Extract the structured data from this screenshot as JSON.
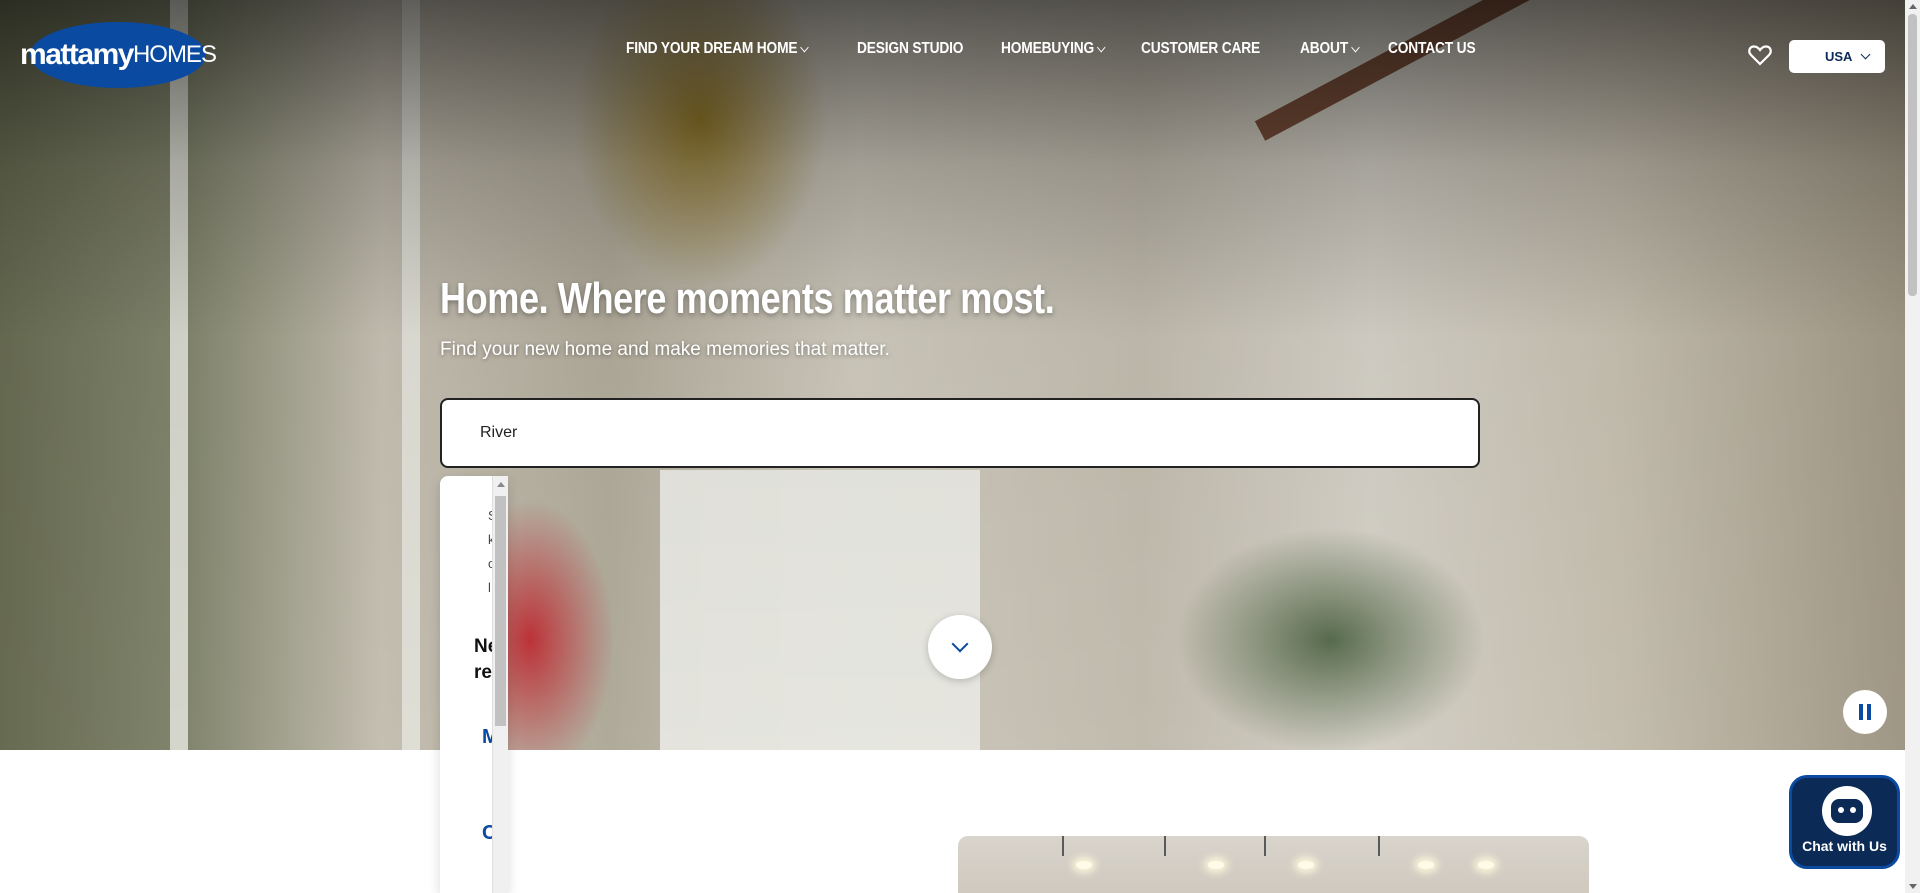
{
  "header": {
    "logo_main": "mattamy",
    "logo_sub": "HOMES",
    "nav": [
      {
        "label": "FIND YOUR DREAM HOME",
        "dropdown": true
      },
      {
        "label": "DESIGN STUDIO",
        "dropdown": false
      },
      {
        "label": "HOMEBUYING",
        "dropdown": true
      },
      {
        "label": "CUSTOMER CARE",
        "dropdown": false
      },
      {
        "label": "ABOUT",
        "dropdown": true
      },
      {
        "label": "CONTACT US",
        "dropdown": false
      }
    ],
    "favorites_icon": "heart-icon",
    "country_selector": "USA"
  },
  "hero": {
    "headline": "Home. Where moments matter most.",
    "subhead": "Find your new home and make memories that matter.",
    "search_value": "River",
    "scroll_down_icon": "chevron-down-icon",
    "pause_icon": "pause-icon"
  },
  "search_dropdown": {
    "visible_text_fragments": [
      "S",
      "k",
      "c",
      "l"
    ],
    "heading": [
      "Ne",
      "re"
    ],
    "links": [
      "M",
      "C"
    ]
  },
  "chat": {
    "label": "Chat with Us",
    "icon": "chatbot-icon"
  },
  "colors": {
    "brand_blue": "#0a4aa1",
    "navy": "#0b2a55"
  }
}
